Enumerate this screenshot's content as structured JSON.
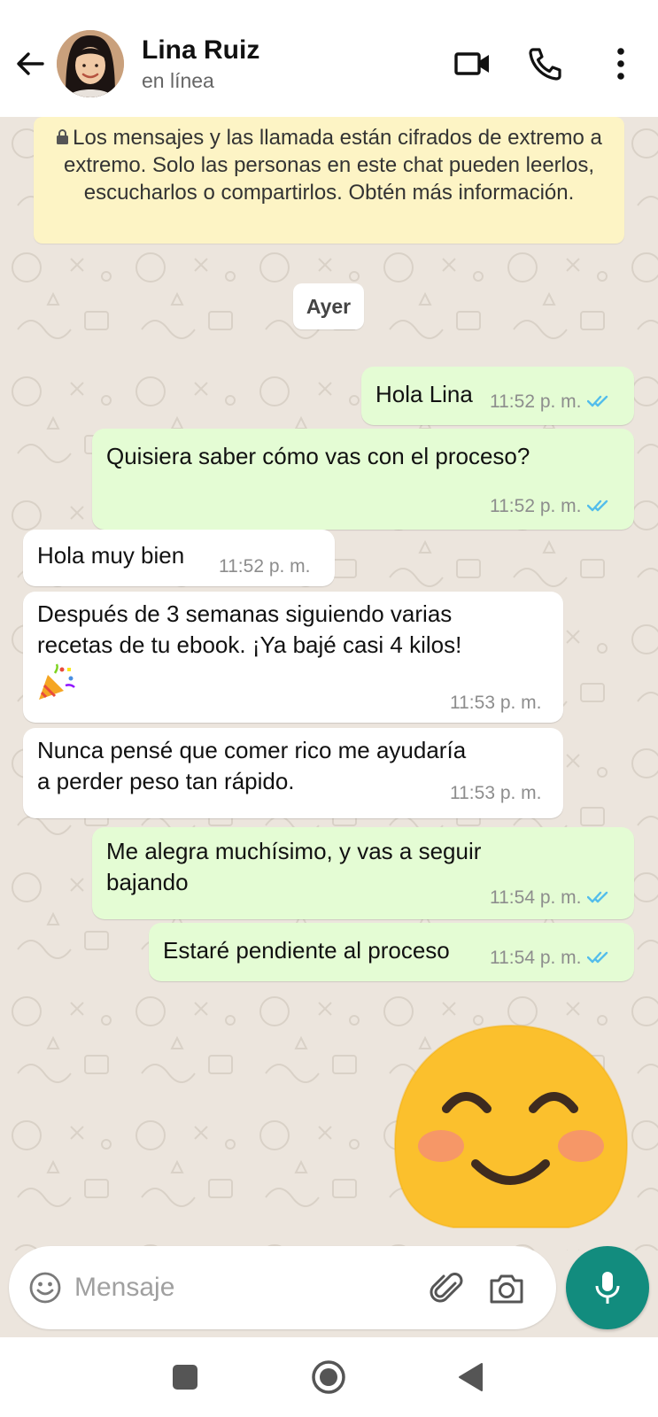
{
  "header": {
    "contact_name": "Lina Ruiz",
    "status": "en línea",
    "icons": [
      "back-arrow-icon",
      "video-call-icon",
      "voice-call-icon",
      "more-options-icon"
    ]
  },
  "notice": {
    "text": "Los mensajes y las llamada están cifrados de extremo a extremo. Solo las personas en este chat pueden leerlos, escucharlos o compartirlos. Obtén más información."
  },
  "day_separator": "Ayer",
  "messages": [
    {
      "direction": "outgoing",
      "text": "Hola Lina",
      "time": "11:52 p. m.",
      "status": "read"
    },
    {
      "direction": "outgoing",
      "text": "Quisiera saber cómo vas con el proceso?",
      "time": "11:52 p. m.",
      "status": "read"
    },
    {
      "direction": "incoming",
      "text": "Hola muy bien",
      "time": "11:52 p. m."
    },
    {
      "direction": "incoming",
      "lines": [
        "Después de 3 semanas siguiendo varias",
        "recetas de tu ebook. ¡Ya bajé casi 4 kilos!"
      ],
      "emoji": "party-popper",
      "time": "11:53 p. m."
    },
    {
      "direction": "incoming",
      "lines": [
        "Nunca pensé que comer rico me ayudaría",
        "a perder peso tan rápido."
      ],
      "time": "11:53 p. m."
    },
    {
      "direction": "outgoing",
      "lines": [
        "Me alegra muchísimo, y vas a seguir",
        "bajando"
      ],
      "time": "11:54 p. m.",
      "status": "read"
    },
    {
      "direction": "outgoing",
      "text": "Estaré pendiente al proceso",
      "time": "11:54 p. m.",
      "status": "read"
    },
    {
      "direction": "outgoing",
      "sticker": "smiling-face-with-smiling-eyes-emoji"
    }
  ],
  "composer": {
    "placeholder": "Mensaje",
    "value": "",
    "icons": [
      "emoji-icon",
      "attach-icon",
      "camera-icon",
      "mic-icon"
    ]
  },
  "system_nav": [
    "recents-icon",
    "home-icon",
    "back-icon"
  ],
  "colors": {
    "accent": "#128C7E",
    "outgoing_bubble": "#E4FCD4",
    "incoming_bubble": "#FFFFFF",
    "notice_bg": "#FDF4C5",
    "read_ticks": "#53BDEB",
    "chat_bg": "#ECE5DD"
  }
}
